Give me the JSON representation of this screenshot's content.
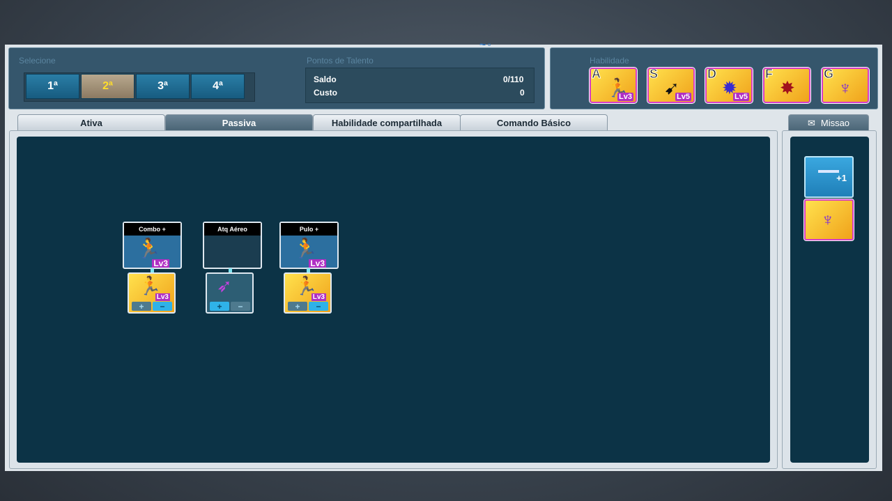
{
  "select": {
    "label": "Selecione",
    "options": [
      "1ª",
      "2ª",
      "3ª",
      "4ª"
    ],
    "selected_index": 1
  },
  "talent": {
    "label": "Pontos de Talento",
    "saldo_label": "Saldo",
    "saldo_value": "0/110",
    "custo_label": "Custo",
    "custo_value": "0"
  },
  "habilidade": {
    "label": "Habilidade",
    "slots": [
      {
        "key": "A",
        "level": "Lv3"
      },
      {
        "key": "S",
        "level": "Lv5"
      },
      {
        "key": "D",
        "level": "Lv5"
      },
      {
        "key": "F",
        "level": ""
      },
      {
        "key": "G",
        "level": ""
      }
    ]
  },
  "tabs": [
    "Ativa",
    "Passiva",
    "Habilidade compartilhada",
    "Comando Básico"
  ],
  "active_tab": "Passiva",
  "missao_tab": "Missao",
  "passives": [
    {
      "title": "Combo +",
      "level": "Lv3",
      "sub_level": "Lv3",
      "plus": "+",
      "minus": "−"
    },
    {
      "title": "Atq Aéreo",
      "level": "",
      "sub_level": "",
      "plus": "+",
      "minus": "−"
    },
    {
      "title": "Pulo +",
      "level": "Lv3",
      "sub_level": "Lv3",
      "plus": "+",
      "minus": "−"
    }
  ],
  "side": {
    "bonus_label": "+1"
  }
}
